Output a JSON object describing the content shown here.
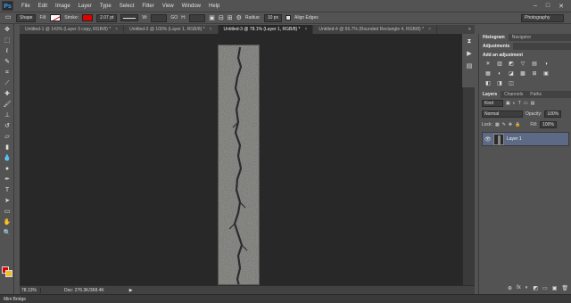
{
  "app": {
    "logo": "Ps"
  },
  "menu": [
    "File",
    "Edit",
    "Image",
    "Layer",
    "Type",
    "Select",
    "Filter",
    "View",
    "Window",
    "Help"
  ],
  "window_controls": [
    "–",
    "□",
    "✕"
  ],
  "options": {
    "tool_mode": "Shape",
    "fill_label": "Fill:",
    "stroke_label": "Stroke:",
    "stroke_width": "2.07 pt",
    "w_label": "W:",
    "go_label": "GO",
    "h_label": "H:",
    "radius_label": "Radius:",
    "radius_value": "10 px",
    "align_edges": "Align Edges",
    "workspace": "Photography"
  },
  "tabs": [
    {
      "label": "Untitled-1 @ 143% (Layer 3 copy, RGB/8) *",
      "active": false
    },
    {
      "label": "Untitled-2 @ 100% (Layer 1, RGB/8) *",
      "active": false
    },
    {
      "label": "Untitled-3 @ 78.1% (Layer 1, RGB/8) *",
      "active": true
    },
    {
      "label": "Untitled-4 @ 66.7% (Rounded Rectangle 4, RGB/8) *",
      "active": false
    }
  ],
  "tabs_more": "»",
  "status": {
    "zoom": "78.13%",
    "doc_info": "Doc: 276.3K/368.4K",
    "arrow": "▶"
  },
  "mini_bridge": "Mini Bridge",
  "panels": {
    "top_tabs": [
      "Histogram",
      "Navigator"
    ],
    "adjust_tabs": [
      "Adjustments"
    ],
    "adjust_title": "Add an adjustment",
    "adjust_icons": [
      "☀",
      "▥",
      "◩",
      "▽",
      "▤",
      "◑",
      "▦",
      "◐",
      "◪",
      "▩",
      "⊞",
      "▣",
      "◧",
      "◨",
      "◫"
    ],
    "layer_tabs": [
      "Layers",
      "Channels",
      "Paths"
    ],
    "kind": "Kind",
    "blend_mode": "Normal",
    "opacity_label": "Opacity:",
    "opacity_value": "100%",
    "lock_label": "Lock:",
    "fill_label": "Fill:",
    "fill_value": "100%",
    "layer_name": "Layer 1",
    "footer_icons": [
      "⊕",
      "fx",
      "◐",
      "◩",
      "▭",
      "▣",
      "🗑"
    ]
  }
}
